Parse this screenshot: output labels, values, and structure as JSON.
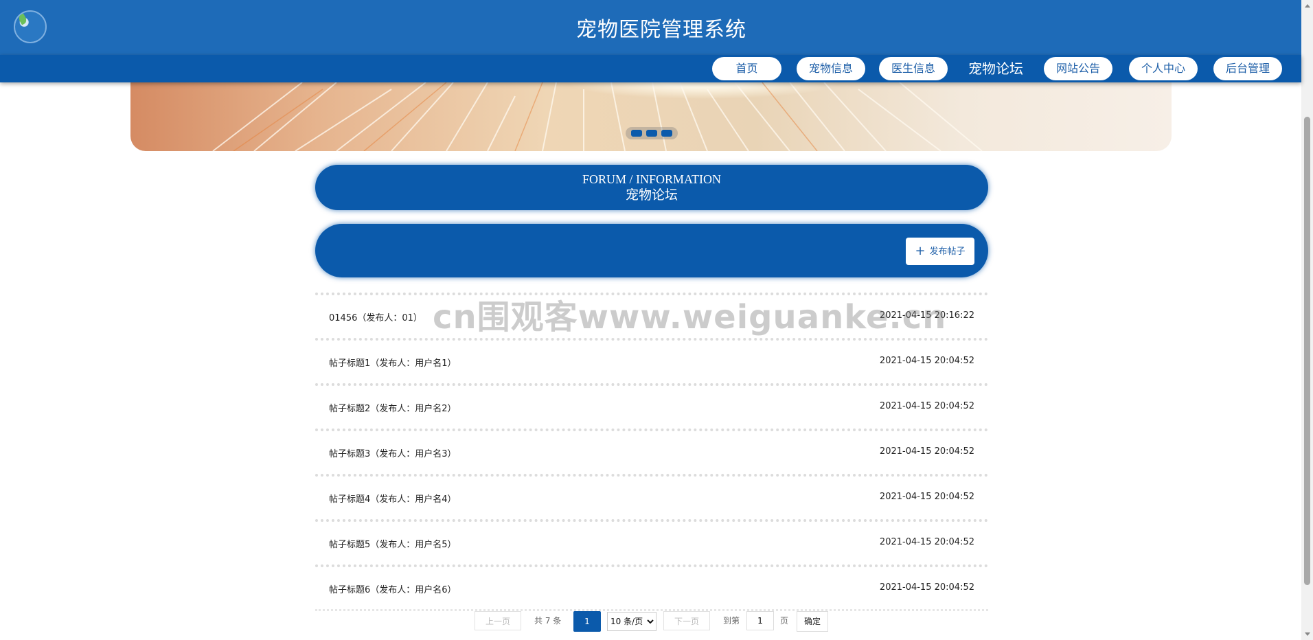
{
  "header": {
    "site_title": "宠物医院管理系统"
  },
  "nav": {
    "items": [
      {
        "label": "首页",
        "active": false
      },
      {
        "label": "宠物信息",
        "active": false
      },
      {
        "label": "医生信息",
        "active": false
      },
      {
        "label": "宠物论坛",
        "active": true
      },
      {
        "label": "网站公告",
        "active": false
      },
      {
        "label": "个人中心",
        "active": false
      },
      {
        "label": "后台管理",
        "active": false
      }
    ]
  },
  "banner": {
    "dot_count": 3
  },
  "section": {
    "title_en": "FORUM / INFORMATION",
    "title_cn": "宠物论坛"
  },
  "actions": {
    "publish_label": "发布帖子",
    "publish_icon": "plus-icon"
  },
  "posts": [
    {
      "title": "01456（发布人：01）",
      "time": "2021-04-15 20:16:22"
    },
    {
      "title": "帖子标题1（发布人：用户名1）",
      "time": "2021-04-15 20:04:52"
    },
    {
      "title": "帖子标题2（发布人：用户名2）",
      "time": "2021-04-15 20:04:52"
    },
    {
      "title": "帖子标题3（发布人：用户名3）",
      "time": "2021-04-15 20:04:52"
    },
    {
      "title": "帖子标题4（发布人：用户名4）",
      "time": "2021-04-15 20:04:52"
    },
    {
      "title": "帖子标题5（发布人：用户名5）",
      "time": "2021-04-15 20:04:52"
    },
    {
      "title": "帖子标题6（发布人：用户名6）",
      "time": "2021-04-15 20:04:52"
    }
  ],
  "watermark": "cn围观客www.weiguanke.cn",
  "pagination": {
    "prev_label": "上一页",
    "total_label": "共 7 条",
    "current_page": "1",
    "page_size_selected": "10 条/页",
    "next_label": "下一页",
    "goto_label": "到第",
    "goto_value": "1",
    "page_unit": "页",
    "confirm_label": "确定"
  },
  "colors": {
    "header_bg": "#1e6bb8",
    "nav_bg": "#0b5aab",
    "accent": "#0b5aab"
  }
}
